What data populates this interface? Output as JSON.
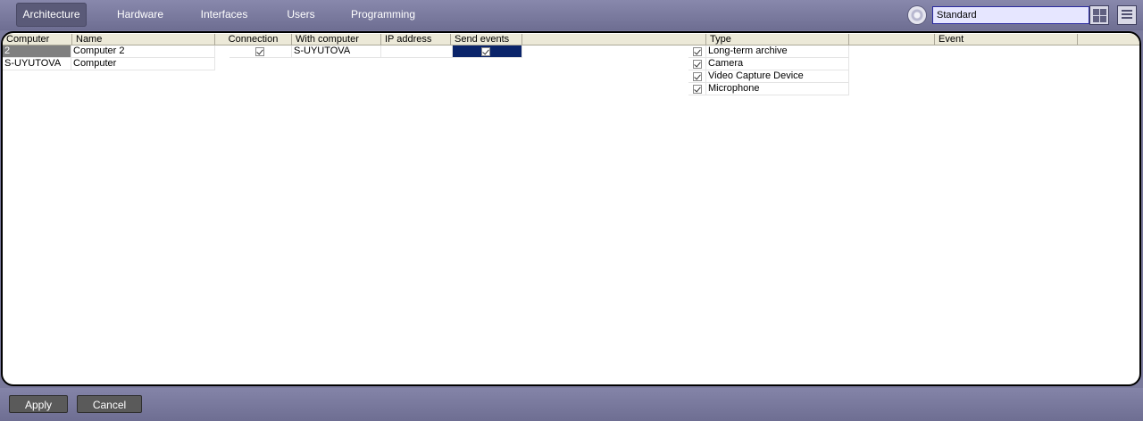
{
  "tabs": [
    {
      "label": "Architecture",
      "active": true
    },
    {
      "label": "Hardware",
      "active": false
    },
    {
      "label": "Interfaces",
      "active": false
    },
    {
      "label": "Users",
      "active": false
    },
    {
      "label": "Programming",
      "active": false
    }
  ],
  "toolbar": {
    "mode_value": "Standard",
    "settings_icon": "gear-icon",
    "layout_icon": "grid-icon",
    "menu_icon": "menu-icon"
  },
  "computers_table": {
    "headers": [
      "Computer",
      "Name"
    ],
    "rows": [
      {
        "computer": "2",
        "name": "Computer 2"
      },
      {
        "computer": "S-UYUTOVA",
        "name": "Computer"
      }
    ]
  },
  "connections_table": {
    "headers": [
      "Connection",
      "With computer",
      "IP address",
      "Send events"
    ],
    "rows": [
      {
        "connection_checked": true,
        "with_computer": "S-UYUTOVA",
        "ip_address": "",
        "send_events_checked": true
      }
    ]
  },
  "events_table": {
    "headers": [
      "Type",
      "Event"
    ],
    "rows": [
      {
        "checked": true,
        "type": "Long-term archive"
      },
      {
        "checked": true,
        "type": "Camera"
      },
      {
        "checked": true,
        "type": "Video Capture Device"
      },
      {
        "checked": true,
        "type": "Microphone"
      }
    ]
  },
  "footer": {
    "apply_label": "Apply",
    "cancel_label": "Cancel"
  },
  "colors": {
    "accent_selection": "#0a246a",
    "toolbar_bg": "#7a7a9c",
    "button_bg": "#5a5a5a"
  }
}
